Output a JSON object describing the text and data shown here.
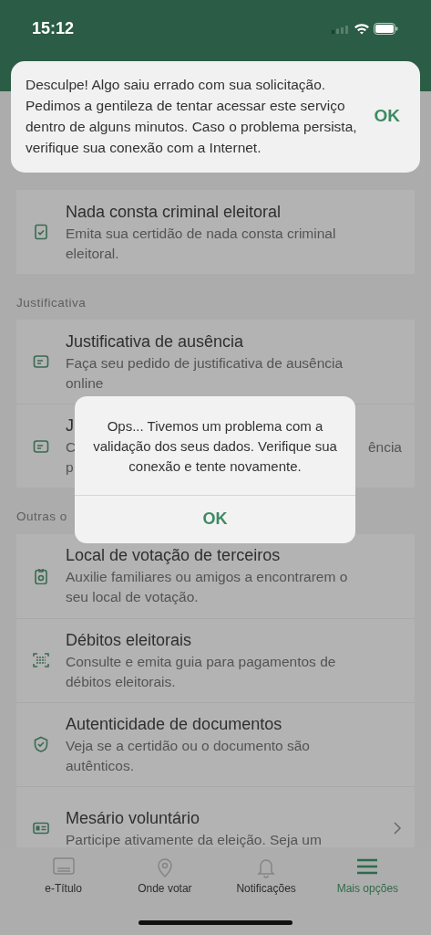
{
  "status_bar": {
    "time": "15:12"
  },
  "toast": {
    "message": "Desculpe! Algo saiu errado com sua solicitação. Pedimos a gentileza de tentar acessar este serviço dentro de alguns minutos. Caso o problema persista, verifique sua conexão com a Internet.",
    "button": "OK"
  },
  "sections": [
    {
      "items": [
        {
          "kind": "full",
          "title": "Nada consta criminal eleitoral",
          "description": "Emita sua certidão de nada consta criminal eleitoral.",
          "chevron": false
        }
      ]
    },
    {
      "header": "Justificativa",
      "items": [
        {
          "kind": "full",
          "title": "Justificativa de ausência",
          "description": "Faça seu pedido de justificativa de ausência online",
          "chevron": false
        },
        {
          "kind": "partly_hidden",
          "title": "J",
          "description_start": "C",
          "description_end": "ência",
          "description_line2": "p",
          "chevron": false
        }
      ]
    },
    {
      "header": "Outras o",
      "items": [
        {
          "kind": "full",
          "title": "Local de votação de terceiros",
          "description": "Auxilie familiares ou amigos a encontrarem o seu local de votação.",
          "chevron": false
        },
        {
          "kind": "full",
          "title": "Débitos eleitorais",
          "description": "Consulte e emita guia para pagamentos de débitos eleitorais.",
          "chevron": false
        },
        {
          "kind": "full",
          "title": "Autenticidade de documentos",
          "description": "Veja se a certidão ou o documento são autênticos.",
          "chevron": false
        },
        {
          "kind": "full",
          "title": "Mesário voluntário",
          "description": "Participe ativamente da eleição. Seja um",
          "chevron": true
        }
      ]
    }
  ],
  "dialog": {
    "message": "Ops... Tivemos um problema com a validação dos seus dados. Verifique sua conexão e tente novamente.",
    "button": "OK"
  },
  "tabs": [
    {
      "label": "e-Título",
      "selected": false
    },
    {
      "label": "Onde votar",
      "selected": false
    },
    {
      "label": "Notificações",
      "selected": false
    },
    {
      "label": "Mais opções",
      "selected": true
    }
  ]
}
